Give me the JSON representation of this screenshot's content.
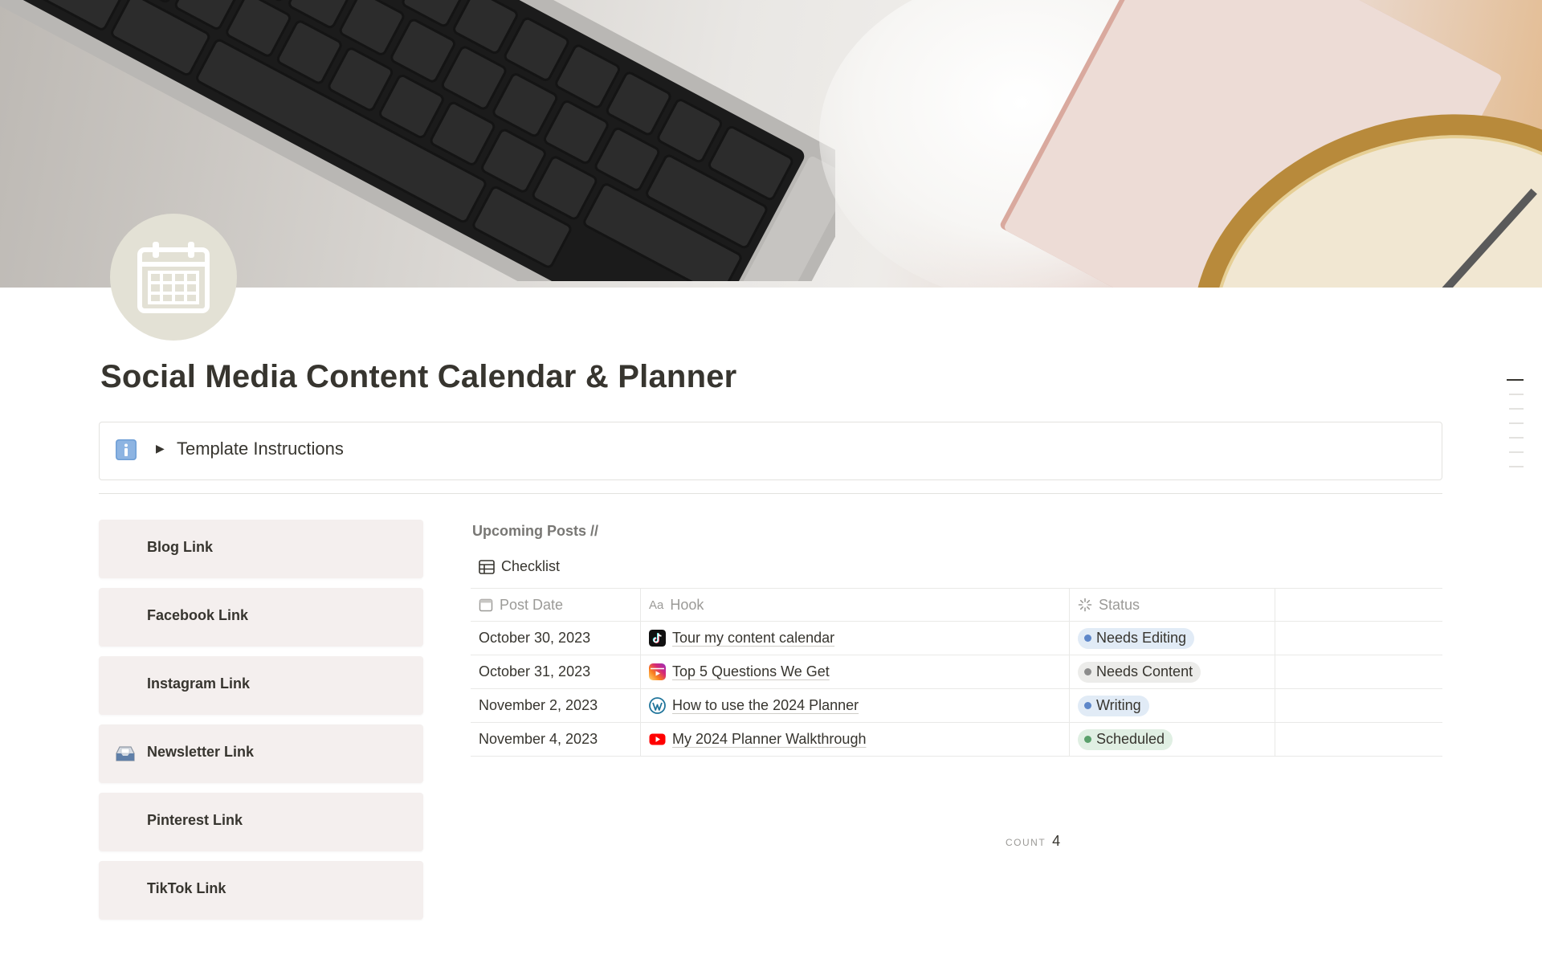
{
  "page": {
    "title": "Social Media Content Calendar & Planner",
    "icon": "calendar-icon"
  },
  "callout": {
    "icon": "info-icon",
    "label": "Template Instructions"
  },
  "links": [
    {
      "label": "Blog Link",
      "icon": ""
    },
    {
      "label": "Facebook Link",
      "icon": ""
    },
    {
      "label": "Instagram Link",
      "icon": ""
    },
    {
      "label": "Newsletter Link",
      "icon": "mail-inbox-icon"
    },
    {
      "label": "Pinterest Link",
      "icon": ""
    },
    {
      "label": "TikTok Link",
      "icon": ""
    }
  ],
  "database": {
    "title": "Upcoming Posts //",
    "view": {
      "label": "Checklist",
      "icon": "table-icon"
    },
    "columns": {
      "post_date": {
        "label": "Post Date",
        "icon": "calendar-property-icon"
      },
      "hook": {
        "label": "Hook",
        "icon": "text-property-icon",
        "icon_text": "Aa"
      },
      "status": {
        "label": "Status",
        "icon": "status-property-icon"
      }
    },
    "rows": [
      {
        "post_date": "October 30, 2023",
        "hook": "Tour my content calendar",
        "source_icon": "tiktok-icon",
        "status": "Needs Editing",
        "status_color": "#5e87c9",
        "status_bg": "#e1ebf6"
      },
      {
        "post_date": "October 31, 2023",
        "hook": "Top 5 Questions We Get",
        "source_icon": "instagram-reels-icon",
        "status": "Needs Content",
        "status_color": "#8c8c8c",
        "status_bg": "#ececea"
      },
      {
        "post_date": "November 2, 2023",
        "hook": "How to use the 2024 Planner",
        "source_icon": "wordpress-icon",
        "status": "Writing",
        "status_color": "#5e87c9",
        "status_bg": "#e1ebf6"
      },
      {
        "post_date": "November 4, 2023",
        "hook": "My 2024 Planner Walkthrough",
        "source_icon": "youtube-icon",
        "status": "Scheduled",
        "status_color": "#5aa06b",
        "status_bg": "#e0efe3"
      }
    ],
    "count_label": "COUNT",
    "count_value": "4"
  },
  "colors": {
    "text": "#37352f",
    "muted": "#9b9a97",
    "link_button_bg": "#f4efee",
    "icon_circle_bg": "#e3e1d5"
  }
}
